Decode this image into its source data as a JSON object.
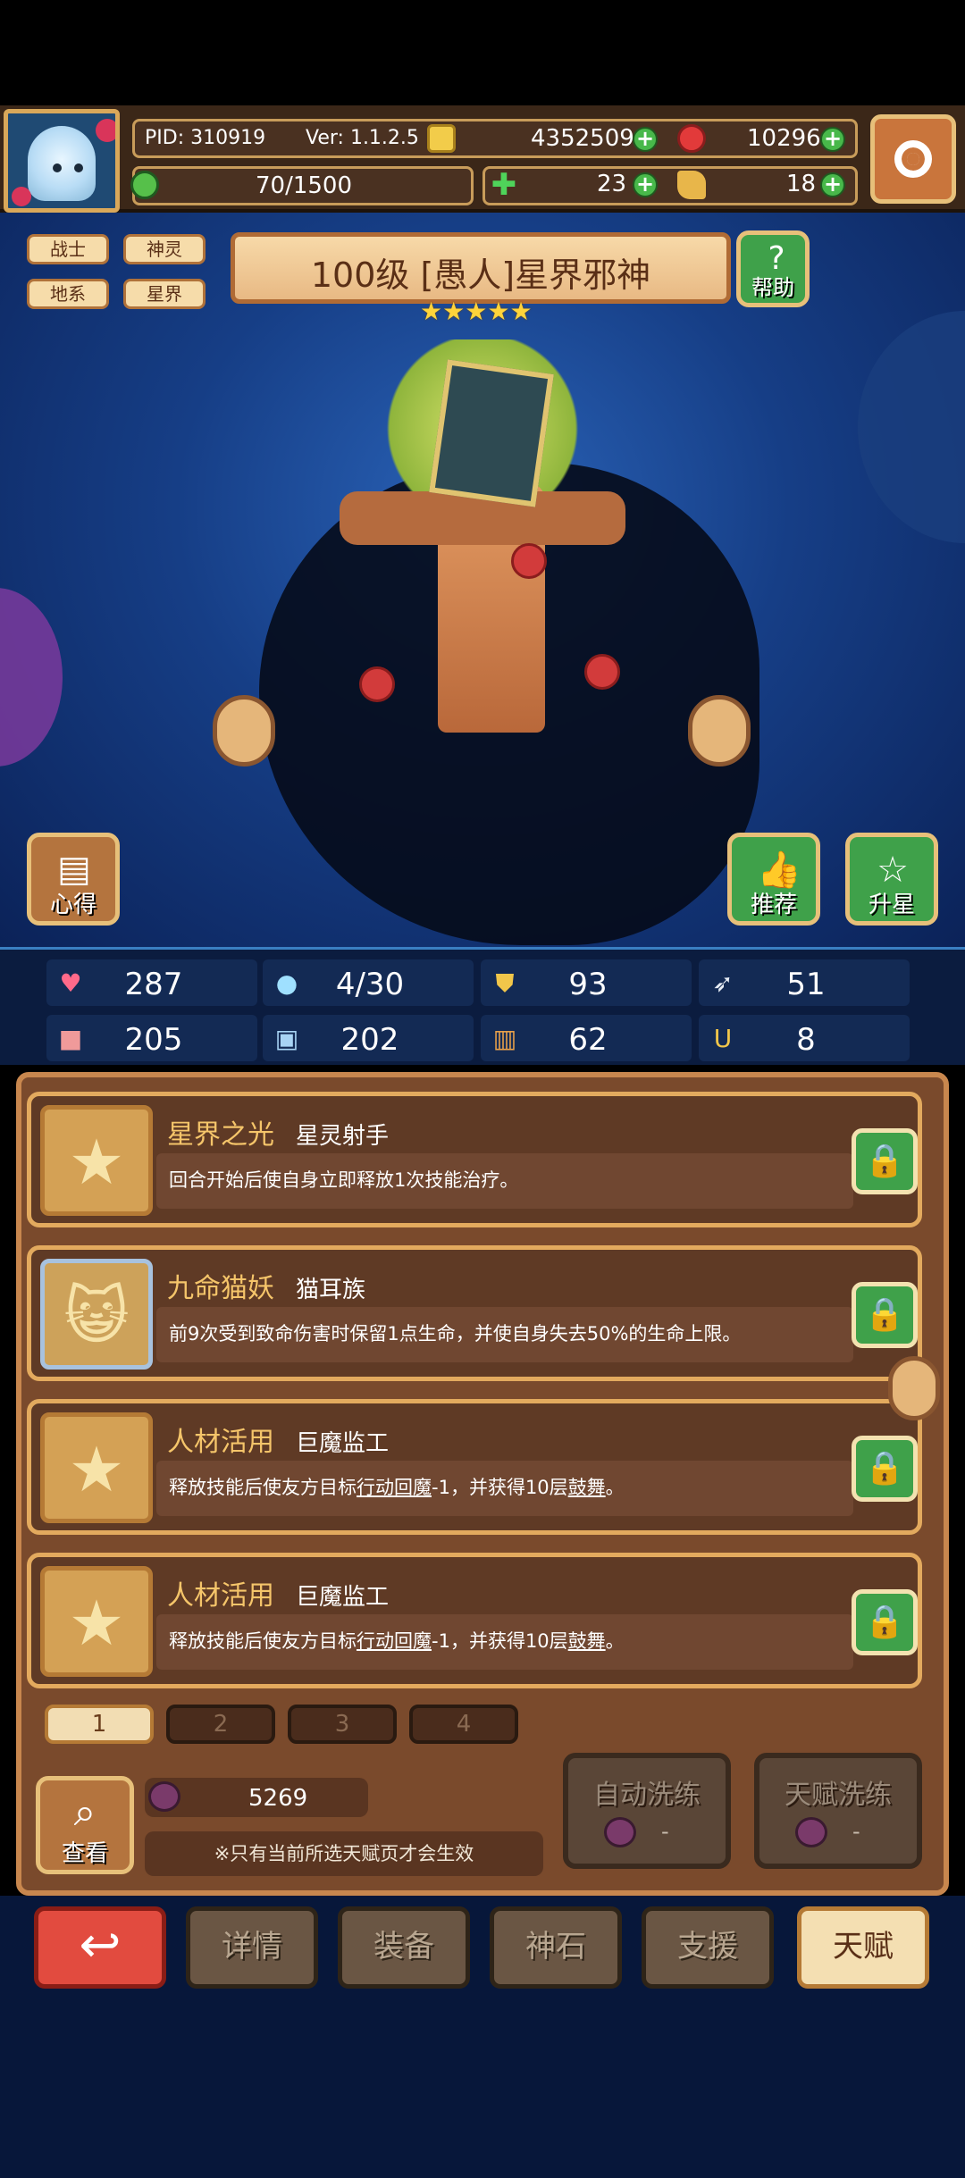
{
  "header": {
    "pid": "PID: 310919",
    "version": "Ver: 1.1.2.5",
    "gold": "4352509",
    "ruby": "10296",
    "energy": "70/1500",
    "clover": "23",
    "item": "18"
  },
  "hero": {
    "title": "100级  [愚人]星界邪神",
    "stars": 5,
    "tags": [
      "战士",
      "神灵",
      "地系",
      "星界"
    ],
    "help_label": "帮助",
    "notes_label": "心得",
    "recommend_label": "推荐",
    "starup_label": "升星"
  },
  "stats": [
    {
      "icon": "heart-icon",
      "value": "287"
    },
    {
      "icon": "drop-icon",
      "value": "4/30"
    },
    {
      "icon": "shield-icon",
      "value": "93"
    },
    {
      "icon": "wing-icon",
      "value": "51"
    },
    {
      "icon": "fist-icon",
      "value": "205"
    },
    {
      "icon": "book-icon",
      "value": "202"
    },
    {
      "icon": "scroll-icon",
      "value": "62"
    },
    {
      "icon": "horseshoe-icon",
      "value": "8"
    }
  ],
  "talents": [
    {
      "name": "星界之光",
      "sub": "星灵射手",
      "desc": "回合开始后使自身立即释放1次技能治疗。"
    },
    {
      "name": "九命猫妖",
      "sub": "猫耳族",
      "desc": "前9次受到致命伤害时保留1点生命，并使自身失去50%的生命上限。"
    },
    {
      "name": "人材活用",
      "sub": "巨魔监工",
      "desc_a": "释放技能后使友方目标",
      "link_a": "行动回魔",
      "desc_b": "-1，并获得10层",
      "link_b": "鼓舞",
      "desc_c": "。"
    },
    {
      "name": "人材活用",
      "sub": "巨魔监工",
      "desc_a": "释放技能后使友方目标",
      "link_a": "行动回魔",
      "desc_b": "-1，并获得10层",
      "link_b": "鼓舞",
      "desc_c": "。"
    }
  ],
  "pages": [
    "1",
    "2",
    "3",
    "4"
  ],
  "active_page": 0,
  "footer": {
    "view_label": "查看",
    "berry_count": "5269",
    "note": "※只有当前所选天赋页才会生效",
    "auto_wash": "自动洗练",
    "talent_wash": "天赋洗练",
    "dash": "-"
  },
  "nav": [
    "详情",
    "装备",
    "神石",
    "支援",
    "天赋"
  ],
  "active_nav": 4,
  "colors": {
    "accent_green": "#3fa14a",
    "gold_text": "#f5c56a",
    "back_red": "#e24b3f"
  }
}
